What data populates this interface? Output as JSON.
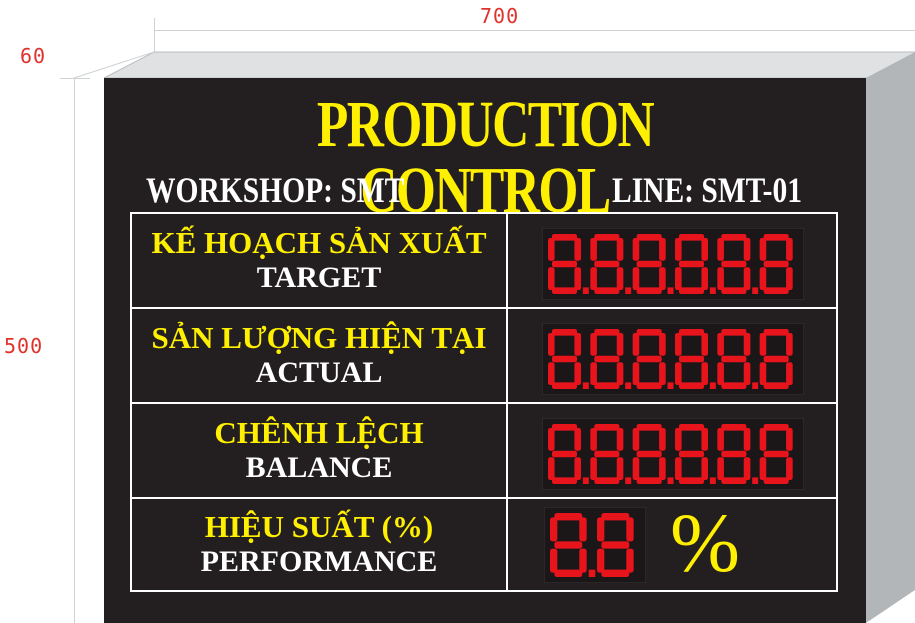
{
  "dimensions": {
    "width_label": "700",
    "depth_label": "60",
    "height_label": "500"
  },
  "board": {
    "title": "PRODUCTION CONTROL",
    "workshop": "WORKSHOP: SMT",
    "line": "LINE: SMT-01",
    "rows": [
      {
        "vn": "KẾ HOẠCH SẢN XUẤT",
        "en": "TARGET",
        "display": "8.8.8.8.8.8"
      },
      {
        "vn": "SẢN LƯỢNG HIỆN TẠI",
        "en": "ACTUAL",
        "display": "8.8.8.8.8.8"
      },
      {
        "vn": "CHÊNH LỆCH",
        "en": "BALANCE",
        "display": "8.8.8.8.8.8"
      },
      {
        "vn": "HIỆU SUẤT (%)",
        "en": "PERFORMANCE",
        "display": "8.8",
        "unit": "%"
      }
    ]
  },
  "colors": {
    "board_bg": "#231f20",
    "title_text": "#ffef00",
    "label_text": "#ffffff",
    "led_on": "#e8141c",
    "led_off": "#3a0d0d",
    "dimension_text": "#e0322b"
  }
}
